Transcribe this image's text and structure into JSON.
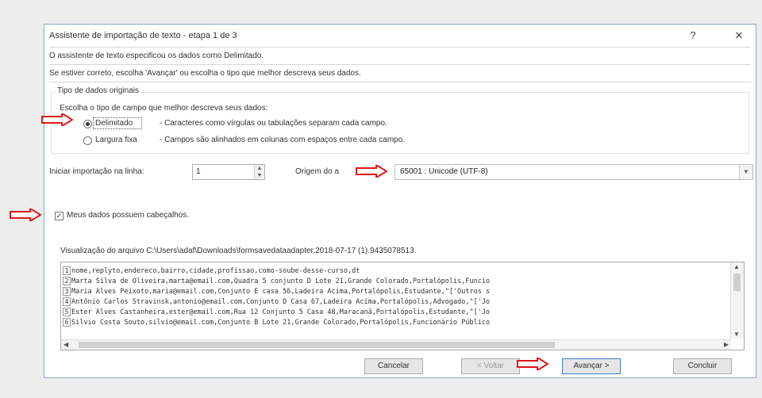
{
  "dialog": {
    "title": "Assistente de importação de texto - etapa 1 de 3",
    "help_label": "?",
    "close_label": "✕",
    "line1": "O assistente de texto especificou os dados como Delimitado.",
    "line2": "Se estiver correto, escolha 'Avançar' ou escolha o tipo que melhor descreva seus dados."
  },
  "group": {
    "title": "Tipo de dados originais",
    "prompt": "Escolha o tipo de campo que melhor descreva seus dados:",
    "options": [
      {
        "label": "Delimitado",
        "desc": "- Caracteres como vírgulas ou tabulações separam cada campo.",
        "selected": true
      },
      {
        "label": "Largura fixa",
        "desc": "- Campos são alinhados em colunas com espaços entre cada campo.",
        "selected": false
      }
    ]
  },
  "import": {
    "start_label": "Iniciar importação na linha:",
    "start_value": "1",
    "origin_label": "Origem do a",
    "origin_value": "65001 : Unicode (UTF-8)"
  },
  "headers": {
    "label": "Meus dados possuem cabeçalhos.",
    "checked": true
  },
  "preview": {
    "label": "Visualização do arquivo C:\\Users\\adaf\\Downloads\\formsavedataadapter.2018-07-17 (1).9435078513.",
    "lines": [
      {
        "num": "1",
        "text": "nome,replyto,endereco,bairro,cidade,profissao,como-soube-desse-curso,dt"
      },
      {
        "num": "2",
        "text": "Marta Silva de Oliveira,marta@email.com,Quadra 5 conjunto D Lote 21,Grande Colorado,Portalópolis,Funcio"
      },
      {
        "num": "3",
        "text": "Maria Alves Peixoto,maria@email.com,Conjunto E casa 56,Ladeira Acima,Portalópolis,Estudante,\"['Outros s"
      },
      {
        "num": "4",
        "text": "Antônio Carlos Stravinsk,antonio@email.com,Conjunto D Casa 67,Ladeira Acima,Portalópolis,Advogado,\"['Jo"
      },
      {
        "num": "5",
        "text": "Ester Alves Castanheira,ester@email.com,Rua 12 Conjunto 5 Casa 48,Maracanã,Portalópolis,Estudante,\"['Jo"
      },
      {
        "num": "6",
        "text": "Silvio Costa Souto,silvio@email.com,Conjunto B Lote 21,Grande Colorado,Portalópolis,Funcionário Público"
      }
    ]
  },
  "buttons": {
    "cancel": "Cancelar",
    "back": "< Voltar",
    "next": "Avançar >",
    "finish": "Concluir"
  },
  "colors": {
    "arrow": "#e0181b",
    "primary_border": "#3c7fd1"
  }
}
